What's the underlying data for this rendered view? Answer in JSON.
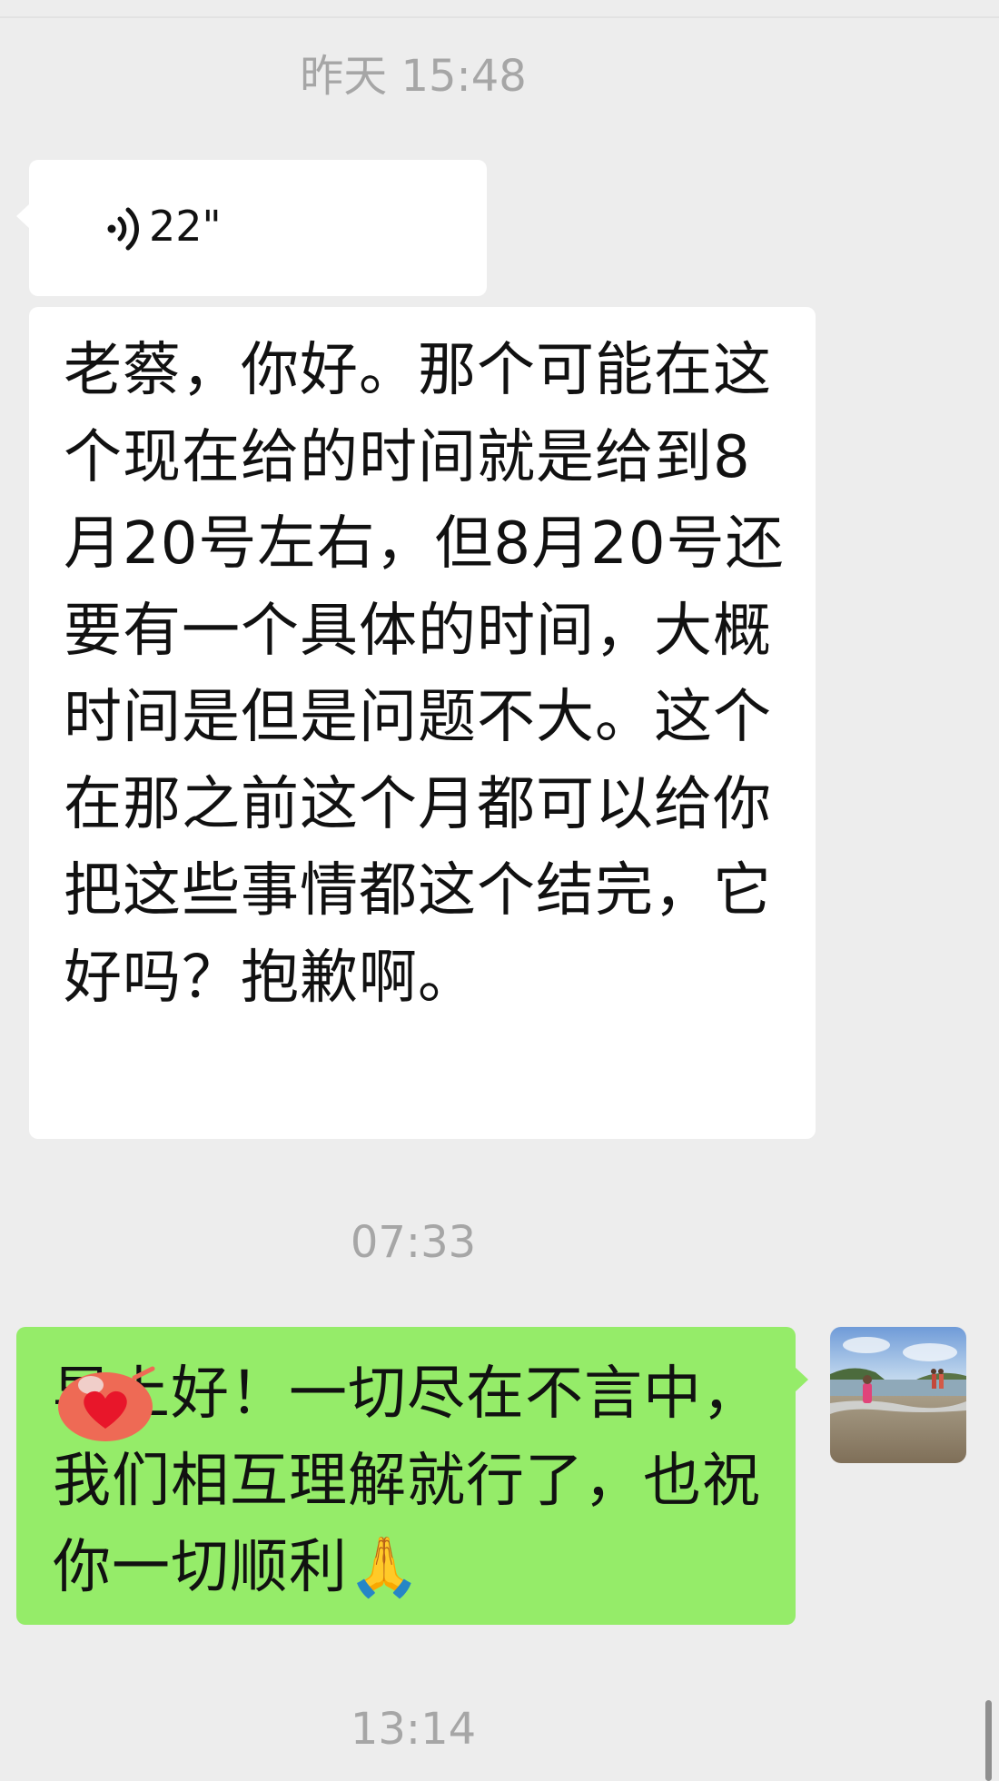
{
  "chat": {
    "timestamp_1": "昨天 15:48",
    "voice_message": {
      "icon": "voice-wave-icon",
      "duration": "22\""
    },
    "incoming_text": "老蔡，你好。那个可能在这个现在给的时间就是给到8月20号左右，但8月20号还要有一个具体的时间，大概时间是但是问题不大。这个在那之前这个月都可以给你把这些事情都这个结完，它好吗？抱歉啊。",
    "timestamp_2": "07:33",
    "outgoing_text": "早上好！一切尽在不言中，我们相互理解就行了，也祝你一切顺利🙏",
    "timestamp_3": "13:14"
  },
  "colors": {
    "background": "#ededed",
    "incoming_bubble": "#ffffff",
    "outgoing_bubble": "#95ec69",
    "timestamp_text": "#a6a6a6"
  }
}
